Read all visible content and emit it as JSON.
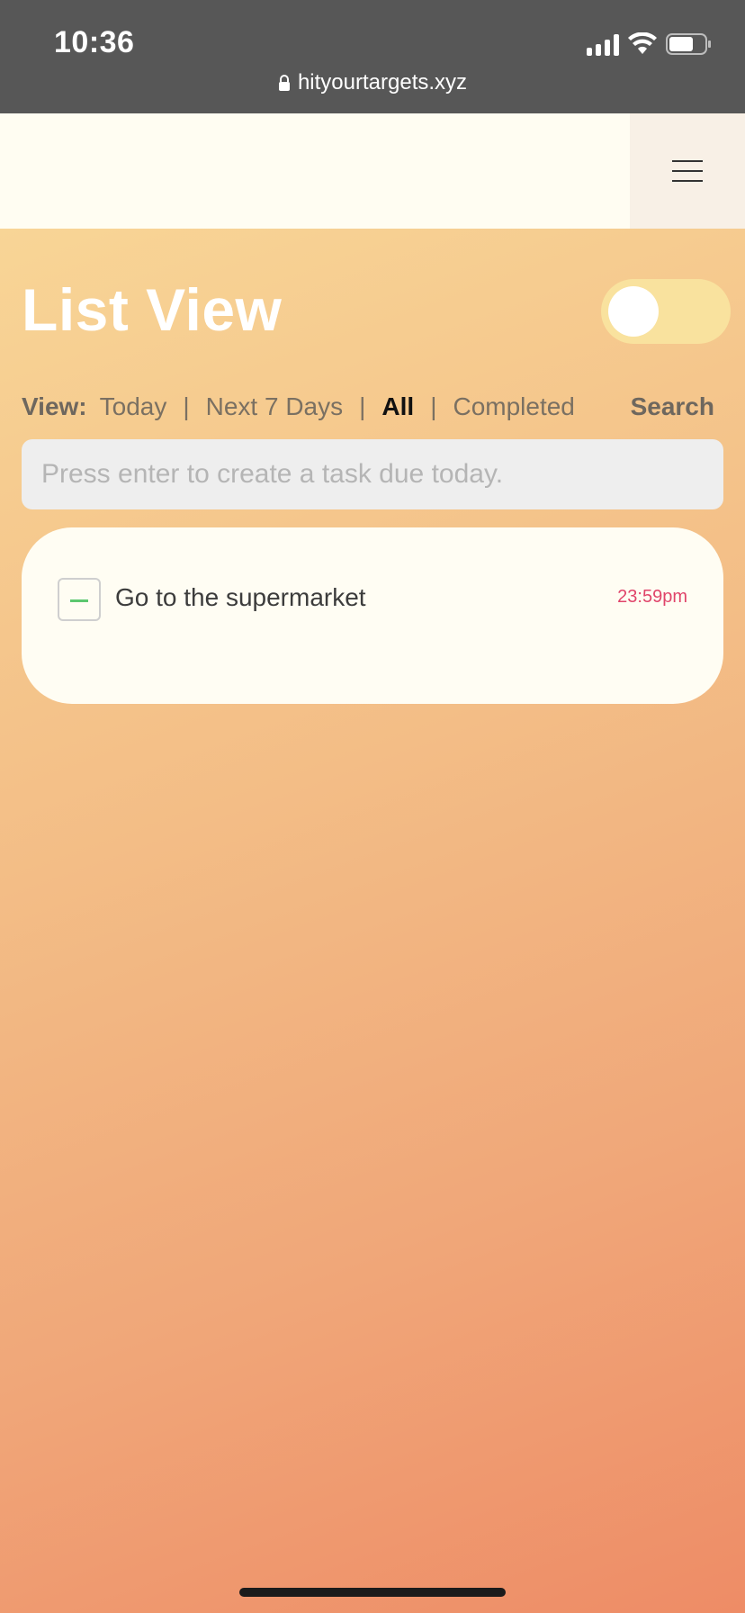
{
  "status_bar": {
    "time": "10:36",
    "url": "hityourtargets.xyz",
    "icons": [
      "signal-icon",
      "wifi-icon",
      "battery-icon",
      "lock-icon"
    ]
  },
  "header": {
    "menu_icon": "hamburger-menu-icon"
  },
  "page": {
    "title": "List View",
    "toggle_on": false
  },
  "view_bar": {
    "label": "View:",
    "options": [
      "Today",
      "Next 7 Days",
      "All",
      "Completed"
    ],
    "active": "All",
    "separator": "|",
    "search_label": "Search"
  },
  "task_input": {
    "placeholder": "Press enter to create a task due today.",
    "value": ""
  },
  "tasks": [
    {
      "title": "Go to the supermarket",
      "time": "23:59pm"
    }
  ],
  "colors": {
    "status_bar": "#575757",
    "gradient_start": "#f8d596",
    "gradient_end": "#ee8c66",
    "toggle_track": "#f9e29e",
    "time_accent": "#e0446a",
    "checkbox_dash": "#5cc76f"
  }
}
